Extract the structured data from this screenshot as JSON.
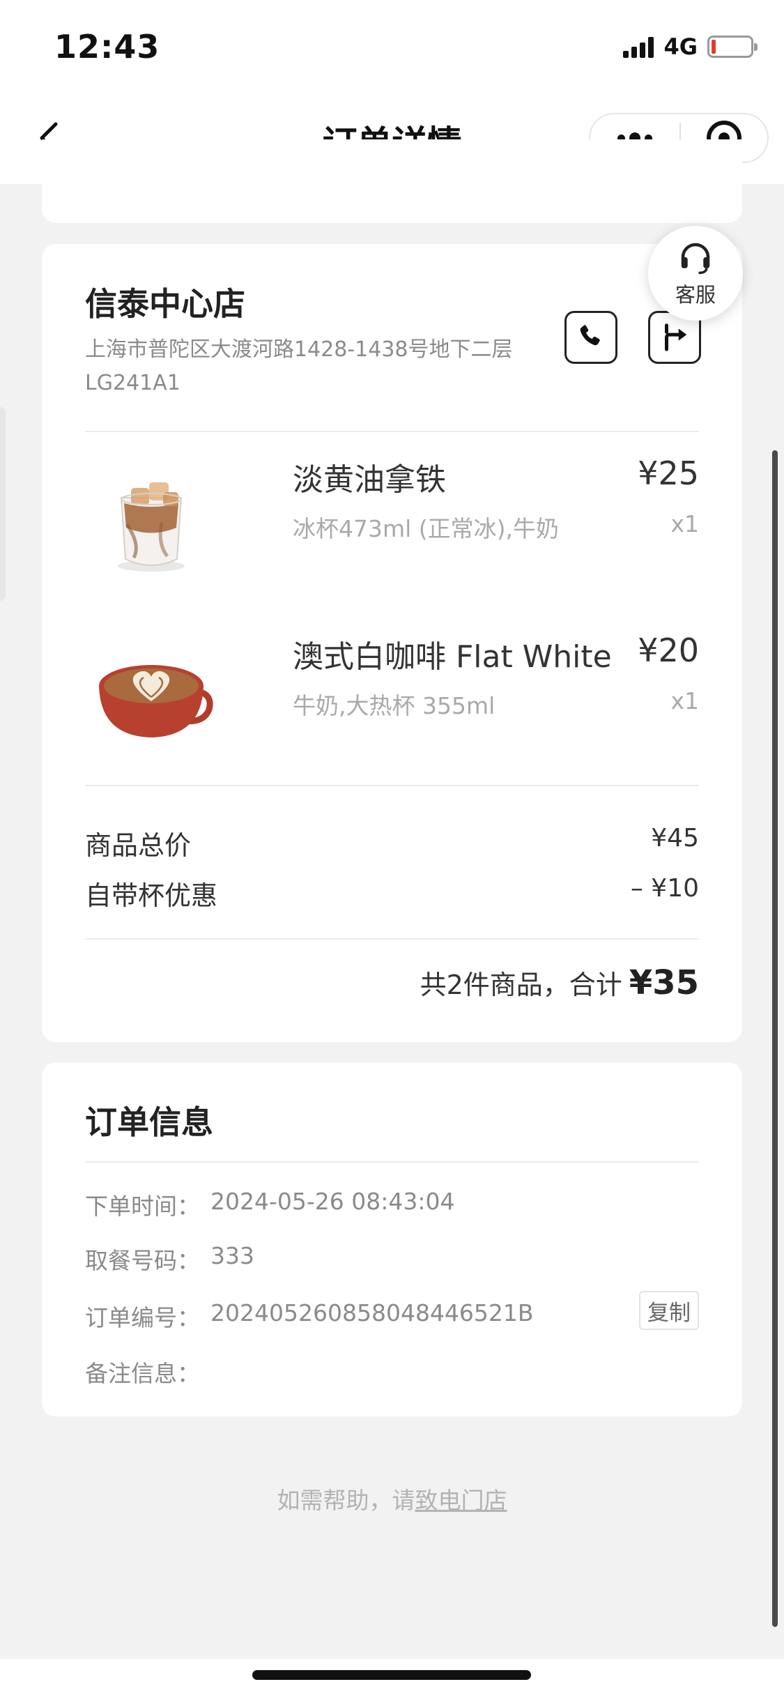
{
  "status_bar": {
    "time": "12:43",
    "network": "4G"
  },
  "nav": {
    "title": "订单详情"
  },
  "store": {
    "name": "信泰中心店",
    "address": "上海市普陀区大渡河路1428-1438号地下二层LG241A1",
    "customer_service_label": "客服"
  },
  "items": [
    {
      "name": "淡黄油拿铁",
      "price": "¥25",
      "spec": "冰杯473ml (正常冰),牛奶",
      "qty": "x1"
    },
    {
      "name": "澳式白咖啡 Flat White",
      "price": "¥20",
      "spec": "牛奶,大热杯 355ml",
      "qty": "x1"
    }
  ],
  "summary": {
    "subtotal_label": "商品总价",
    "subtotal_value": "¥45",
    "discount_label": "自带杯优惠",
    "discount_value": "– ¥10",
    "total_text": "共2件商品，合计",
    "total_amount": "¥35"
  },
  "order_info": {
    "title": "订单信息",
    "order_time_label": "下单时间：",
    "order_time_value": "2024-05-26 08:43:04",
    "pickup_label": "取餐号码：",
    "pickup_value": "333",
    "order_no_label": "订单编号：",
    "order_no_value": "20240526085804844652​1B",
    "copy_label": "复制",
    "remark_label": "备注信息："
  },
  "help": {
    "prefix": "如需帮助，请",
    "link": "致电门店"
  },
  "colors": {
    "background": "#f2f2f2",
    "card": "#ffffff",
    "muted": "#8a8a8a",
    "battery_low": "#e53935"
  }
}
